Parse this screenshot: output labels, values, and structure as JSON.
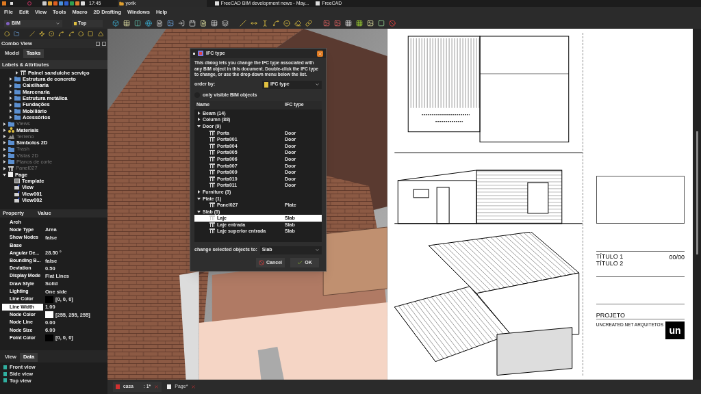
{
  "top_panel": {
    "clock": "17:45",
    "workspace": "yorik",
    "windows": [
      "FreeCAD BIM development news - May...",
      "FreeCAD"
    ]
  },
  "menu": [
    "File",
    "Edit",
    "View",
    "Tools",
    "Macro",
    "2D Drafting",
    "Windows",
    "Help"
  ],
  "toolbar": {
    "workbench": "BIM",
    "view": "Top"
  },
  "combo_view": {
    "title": "Combo View",
    "tabs": [
      {
        "label": "Model",
        "selected": false
      },
      {
        "label": "Tasks",
        "selected": true
      }
    ],
    "tree_header": "Labels & Attributes",
    "tree": [
      {
        "children": [
          {
            "children": [
              {
                "label": "Painel sanduiche serviço",
                "kind": "panel",
                "expanded": false,
                "hidden": false
              }
            ]
          },
          {
            "label": "Estrutura de concreto",
            "kind": "folder",
            "expanded": false,
            "hidden": false
          },
          {
            "label": "Caixilharia",
            "kind": "folder",
            "expanded": false,
            "hidden": false
          },
          {
            "label": "Marcenaria",
            "kind": "folder",
            "expanded": false,
            "hidden": false
          },
          {
            "label": "Estrutura metálica",
            "kind": "folder",
            "expanded": false,
            "hidden": false
          },
          {
            "label": "Fundações",
            "kind": "folder",
            "expanded": false,
            "hidden": false
          },
          {
            "label": "Mobiliário",
            "kind": "folder",
            "expanded": false,
            "hidden": false
          },
          {
            "label": "Acessórios",
            "kind": "folder",
            "expanded": false,
            "hidden": false
          }
        ]
      },
      {
        "label": "Views",
        "kind": "folder",
        "expanded": false,
        "hidden": true
      },
      {
        "label": "Materials",
        "kind": "materials",
        "expanded": false,
        "hidden": false
      },
      {
        "label": "Terreno",
        "kind": "terrain",
        "expanded": false,
        "hidden": true
      },
      {
        "label": "Símbolos 2D",
        "kind": "folder",
        "expanded": false,
        "hidden": false
      },
      {
        "label": "Trash",
        "kind": "folder",
        "expanded": false,
        "hidden": true
      },
      {
        "label": "Vistas 2D",
        "kind": "folder",
        "expanded": false,
        "hidden": true
      },
      {
        "label": "Planos de corte",
        "kind": "folder",
        "expanded": false,
        "hidden": true
      },
      {
        "label": "Panel027",
        "kind": "panel",
        "expanded": false,
        "hidden": true
      },
      {
        "label": "Page",
        "kind": "page",
        "expanded": true,
        "hidden": false,
        "children": [
          {
            "label": "Template",
            "kind": "template",
            "hidden": false
          },
          {
            "label": "View",
            "kind": "view",
            "hidden": false
          },
          {
            "label": "View001",
            "kind": "view",
            "hidden": false
          },
          {
            "label": "View002",
            "kind": "view",
            "hidden": false
          }
        ]
      }
    ],
    "property_columns": [
      "Property",
      "Value"
    ],
    "properties": [
      {
        "kind": "group",
        "name": "Arch"
      },
      {
        "kind": "prop",
        "name": "Node Type",
        "value": "Area",
        "selected": false
      },
      {
        "kind": "prop",
        "name": "Show Nodes",
        "value": "false",
        "selected": false
      },
      {
        "kind": "group",
        "name": "Base"
      },
      {
        "kind": "prop",
        "name": "Angular De...",
        "value": "28.50 °",
        "selected": false
      },
      {
        "kind": "prop",
        "name": "Bounding B...",
        "value": "false",
        "selected": false
      },
      {
        "kind": "prop",
        "name": "Deviation",
        "value": "0.50",
        "selected": false
      },
      {
        "kind": "prop",
        "name": "Display Mode",
        "value": "Flat Lines",
        "selected": false
      },
      {
        "kind": "prop",
        "name": "Draw Style",
        "value": "Solid",
        "selected": false
      },
      {
        "kind": "prop",
        "name": "Lighting",
        "value": "One side",
        "selected": false
      },
      {
        "kind": "prop",
        "name": "Line Color",
        "value": "[0, 0, 0]",
        "color": "#000000",
        "selected": false
      },
      {
        "kind": "prop",
        "name": "Line Width",
        "value": "1.00",
        "selected": true
      },
      {
        "kind": "prop",
        "name": "Node Color",
        "value": "[255, 255, 255]",
        "color": "#ffffff",
        "selected": false
      },
      {
        "kind": "prop",
        "name": "Node Line",
        "value": "0.00",
        "selected": false
      },
      {
        "kind": "prop",
        "name": "Node Size",
        "value": "6.00",
        "selected": false
      },
      {
        "kind": "prop",
        "name": "Point Color",
        "value": "[0, 0, 0]",
        "color": "#000000",
        "selected": false
      }
    ],
    "bottom_tabs": [
      {
        "label": "View",
        "selected": false
      },
      {
        "label": "Data",
        "selected": true
      }
    ],
    "views": [
      "Front view",
      "Side view",
      "Top view"
    ]
  },
  "dialog": {
    "title": "IFC type",
    "description": "This dialog lets you change the IFC type associated with any BIM object in this document. Double-click the IFC type to change, or use the drop-down menu below the list.",
    "order_label": "order by:",
    "order_value": "IFC type",
    "checkbox": {
      "label": "only visible BIM objects",
      "checked": false
    },
    "columns": [
      "Name",
      "IFC type"
    ],
    "groups": [
      {
        "label": "Beam (14)",
        "expanded": false
      },
      {
        "label": "Column (88)",
        "expanded": false
      },
      {
        "label": "Door (9)",
        "expanded": true,
        "children": [
          {
            "name": "Porta",
            "type": "Door",
            "selected": false
          },
          {
            "name": "Porta001",
            "type": "Door",
            "selected": false
          },
          {
            "name": "Porta004",
            "type": "Door",
            "selected": false
          },
          {
            "name": "Porta005",
            "type": "Door",
            "selected": false
          },
          {
            "name": "Porta006",
            "type": "Door",
            "selected": false
          },
          {
            "name": "Porta007",
            "type": "Door",
            "selected": false
          },
          {
            "name": "Porta009",
            "type": "Door",
            "selected": false
          },
          {
            "name": "Porta010",
            "type": "Door",
            "selected": false
          },
          {
            "name": "Porta011",
            "type": "Door",
            "selected": false
          }
        ]
      },
      {
        "label": "Furniture (3)",
        "expanded": false
      },
      {
        "label": "Plate (1)",
        "expanded": true,
        "children": [
          {
            "name": "Panel027",
            "type": "Plate",
            "selected": false
          }
        ]
      },
      {
        "label": "Slab (5)",
        "expanded": true,
        "children": [
          {
            "name": "Laje",
            "type": "Slab",
            "selected": true
          },
          {
            "name": "Laje entrada",
            "type": "Slab",
            "selected": false
          },
          {
            "name": "Laje superior entrada",
            "type": "Slab",
            "selected": false
          }
        ]
      }
    ],
    "change_label": "change selected objects to:",
    "change_value": "Slab",
    "buttons": [
      {
        "label": "Cancel",
        "kind": "cancel"
      },
      {
        "label": "OK",
        "kind": "ok"
      }
    ]
  },
  "drawing": {
    "title_1": "TÍTULO 1",
    "title_2": "TÍTULO 2",
    "sheet": "00/00",
    "project": "PROJETO",
    "office": "UNCREATED.NET ARQUITETOS",
    "logo": "un"
  },
  "document_tabs": [
    {
      "label": "casa",
      "suffix": ": 1*",
      "selected": true
    },
    {
      "label": "Page*",
      "selected": false
    }
  ]
}
